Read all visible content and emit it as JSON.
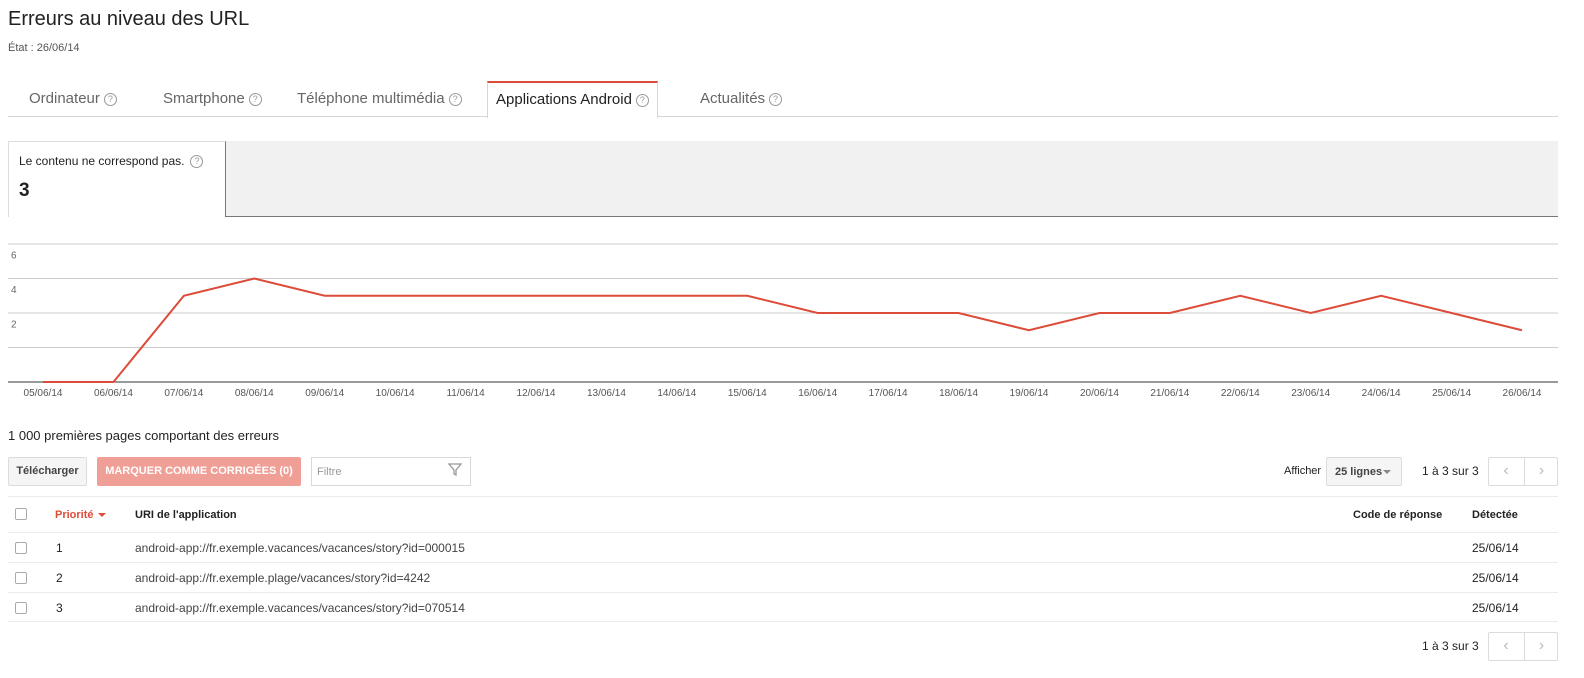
{
  "header": {
    "title": "Erreurs au niveau des URL",
    "state": "État : 26/06/14"
  },
  "tabs": [
    {
      "label": "Ordinateur",
      "active": false
    },
    {
      "label": "Smartphone",
      "active": false
    },
    {
      "label": "Téléphone multimédia",
      "active": false
    },
    {
      "label": "Applications Android",
      "active": true
    },
    {
      "label": "Actualités",
      "active": false
    }
  ],
  "summary_card": {
    "label": "Le contenu ne correspond pas.",
    "value": "3"
  },
  "chart_data": {
    "type": "line",
    "x": [
      "05/06/14",
      "06/06/14",
      "07/06/14",
      "08/06/14",
      "09/06/14",
      "10/06/14",
      "11/06/14",
      "12/06/14",
      "13/06/14",
      "14/06/14",
      "15/06/14",
      "16/06/14",
      "17/06/14",
      "18/06/14",
      "19/06/14",
      "20/06/14",
      "21/06/14",
      "22/06/14",
      "23/06/14",
      "24/06/14",
      "25/06/14",
      "26/06/14"
    ],
    "values": [
      0,
      0,
      5,
      6,
      5,
      5,
      5,
      5,
      5,
      5,
      5,
      4,
      4,
      4,
      3,
      4,
      4,
      5,
      4,
      5,
      4,
      3
    ],
    "yticks": [
      "2",
      "4",
      "6",
      "8"
    ],
    "ylim": [
      0,
      8
    ],
    "grid": true,
    "color": "#dd4b39"
  },
  "list": {
    "heading": "1 000 premières pages comportant des erreurs",
    "download_label": "Télécharger",
    "mark_fixed_label": "MARQUER COMME CORRIGÉES (0)",
    "filter_placeholder": "Filtre",
    "show_label": "Afficher",
    "rows_select": "25 lignes",
    "pagination": "1 à 3 sur 3",
    "columns": {
      "priority": "Priorité",
      "uri": "URI de l'application",
      "code": "Code de réponse",
      "detected": "Détectée"
    },
    "rows": [
      {
        "priority": "1",
        "uri": "android-app://fr.exemple.vacances/vacances/story?id=000015",
        "code": "",
        "detected": "25/06/14"
      },
      {
        "priority": "2",
        "uri": "android-app://fr.exemple.plage/vacances/story?id=4242",
        "code": "",
        "detected": "25/06/14"
      },
      {
        "priority": "3",
        "uri": "android-app://fr.exemple.vacances/vacances/story?id=070514",
        "code": "",
        "detected": "25/06/14"
      }
    ]
  },
  "colors": {
    "accent": "#dd4b39",
    "mark_button": "#ef9f96"
  },
  "icons": {
    "help": "question-circle-icon",
    "filter": "funnel-icon",
    "prev": "chevron-left-icon",
    "next": "chevron-right-icon"
  }
}
